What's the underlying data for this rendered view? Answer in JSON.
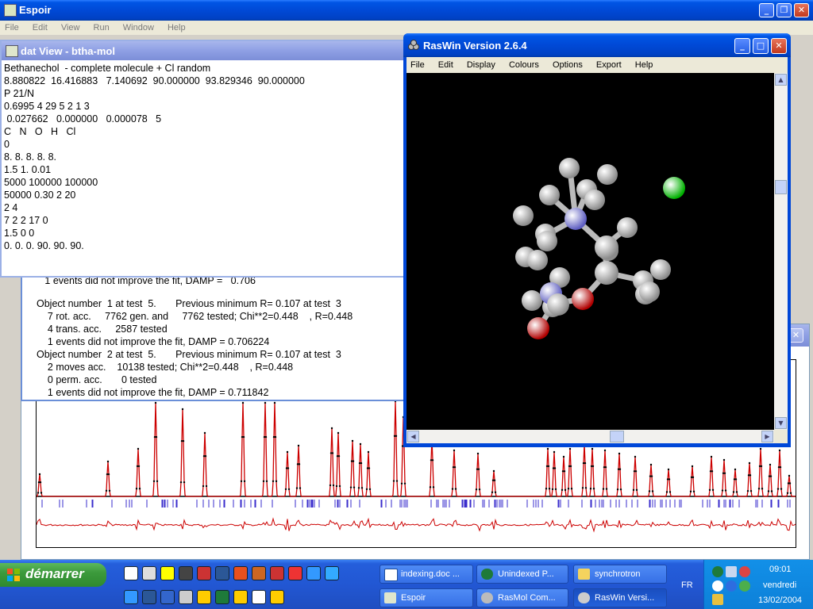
{
  "espoir": {
    "title": "Espoir",
    "menu": [
      "File",
      "Edit",
      "View",
      "Run",
      "Window",
      "Help"
    ]
  },
  "datview": {
    "title": "dat View - btha-mol",
    "lines": [
      "Bethanechol  - complete molecule + Cl random",
      "8.880822  16.416883   7.140692  90.000000  93.829346  90.000000",
      "P 21/N",
      "0.6995 4 29 5 2 1 3",
      " 0.027662   0.000000   0.000078   5",
      "C   N   O   H   Cl",
      "0",
      "8. 8. 8. 8. 8.",
      "1.5 1. 0.01",
      "5000 100000 100000",
      "50000 0.30 2 20",
      "2 4",
      "7 2 2 17 0",
      "1.5 0 0",
      "0. 0. 0. 90. 90. 90."
    ]
  },
  "log": {
    "partial_line": "   1 events did not improve the fit, DAMP =   0.706",
    "lines": [
      "Object number  1 at test  5.       Previous minimum R= 0.107 at test  3",
      "    7 rot. acc.     7762 gen. and     7762 tested; Chi**2=0.448    , R=0.448",
      "    4 trans. acc.     2587 tested",
      "    1 events did not improve the fit, DAMP = 0.706224",
      "Object number  2 at test  5.       Previous minimum R= 0.107 at test  3",
      "    2 moves acc.    10138 tested; Chi**2=0.448    , R=0.448",
      "    0 perm. acc.       0 tested",
      "    1 events did not improve the fit, DAMP = 0.711842"
    ]
  },
  "raswin": {
    "title": "RasWin Version 2.6.4",
    "menu": [
      "File",
      "Edit",
      "Display",
      "Colours",
      "Options",
      "Export",
      "Help"
    ]
  },
  "taskbar": {
    "start_label": "démarrer",
    "row1": [
      "indexing.doc ...",
      "Unindexed P...",
      "synchrotron"
    ],
    "row2": [
      "Espoir",
      "RasMol Com...",
      "RasWin Versi..."
    ],
    "lang": "FR",
    "clock_time": "09:01",
    "clock_day": "vendredi",
    "clock_date": "13/02/2004"
  },
  "colors": {
    "xp_blue": "#0050e0",
    "observed_points": "#000000",
    "calc_curve": "#cc0000",
    "reflection_ticks": "#3a2ccc",
    "atom_carbon": "#c8c8c8",
    "atom_nitrogen": "#8f8fe0",
    "atom_oxygen": "#e00000",
    "atom_chlorine": "#00e000"
  },
  "icons": [
    "espoir-app-icon",
    "raswin-app-icon",
    "windows-flag-icon",
    "dat-view-icon"
  ]
}
